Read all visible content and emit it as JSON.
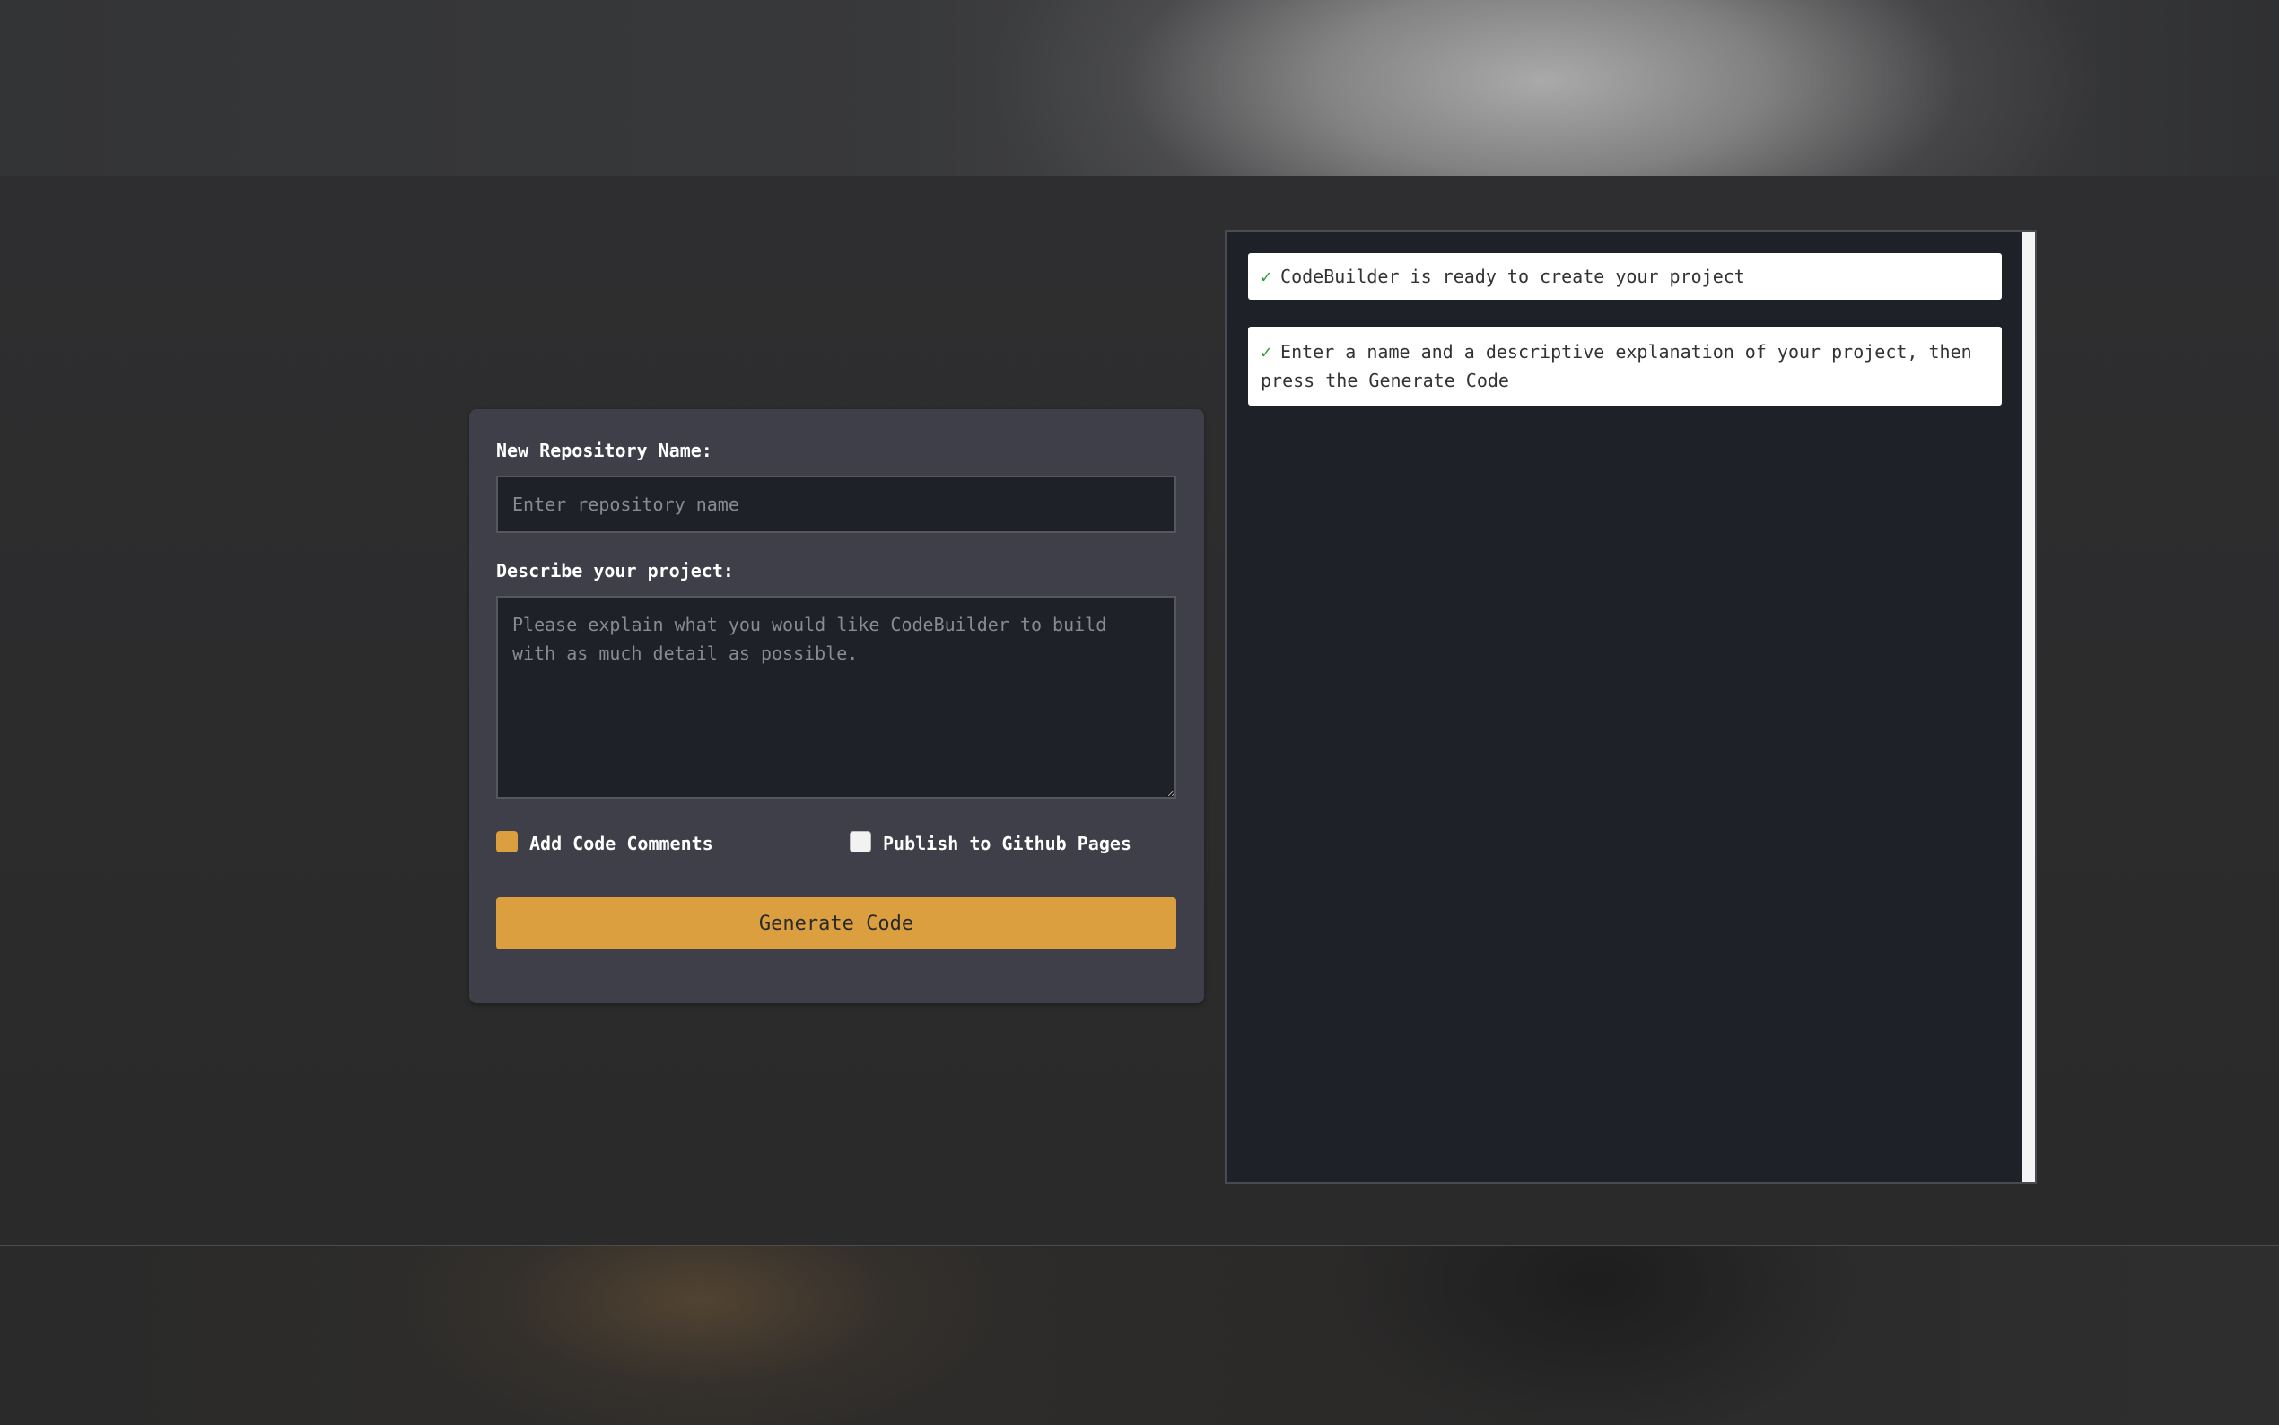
{
  "form": {
    "repo_label": "New Repository Name:",
    "repo_placeholder": "Enter repository name",
    "repo_value": "",
    "desc_label": "Describe your project:",
    "desc_placeholder": "Please explain what you would like CodeBuilder to build with as much detail as possible.",
    "desc_value": "",
    "options": [
      {
        "label": "Add Code Comments",
        "checked": true
      },
      {
        "label": "Publish to Github Pages",
        "checked": false
      }
    ],
    "generate_label": "Generate Code"
  },
  "output": {
    "messages": [
      {
        "icon": "checkmark-icon",
        "text": "CodeBuilder is ready to create your project"
      },
      {
        "icon": "checkmark-icon",
        "text": "Enter a name and a descriptive explanation of your project, then press the Generate Code"
      }
    ]
  },
  "colors": {
    "accent": "#dc9f40",
    "check": "#2e9b3a",
    "card": "#3e3f49",
    "field": "#1f2129"
  }
}
